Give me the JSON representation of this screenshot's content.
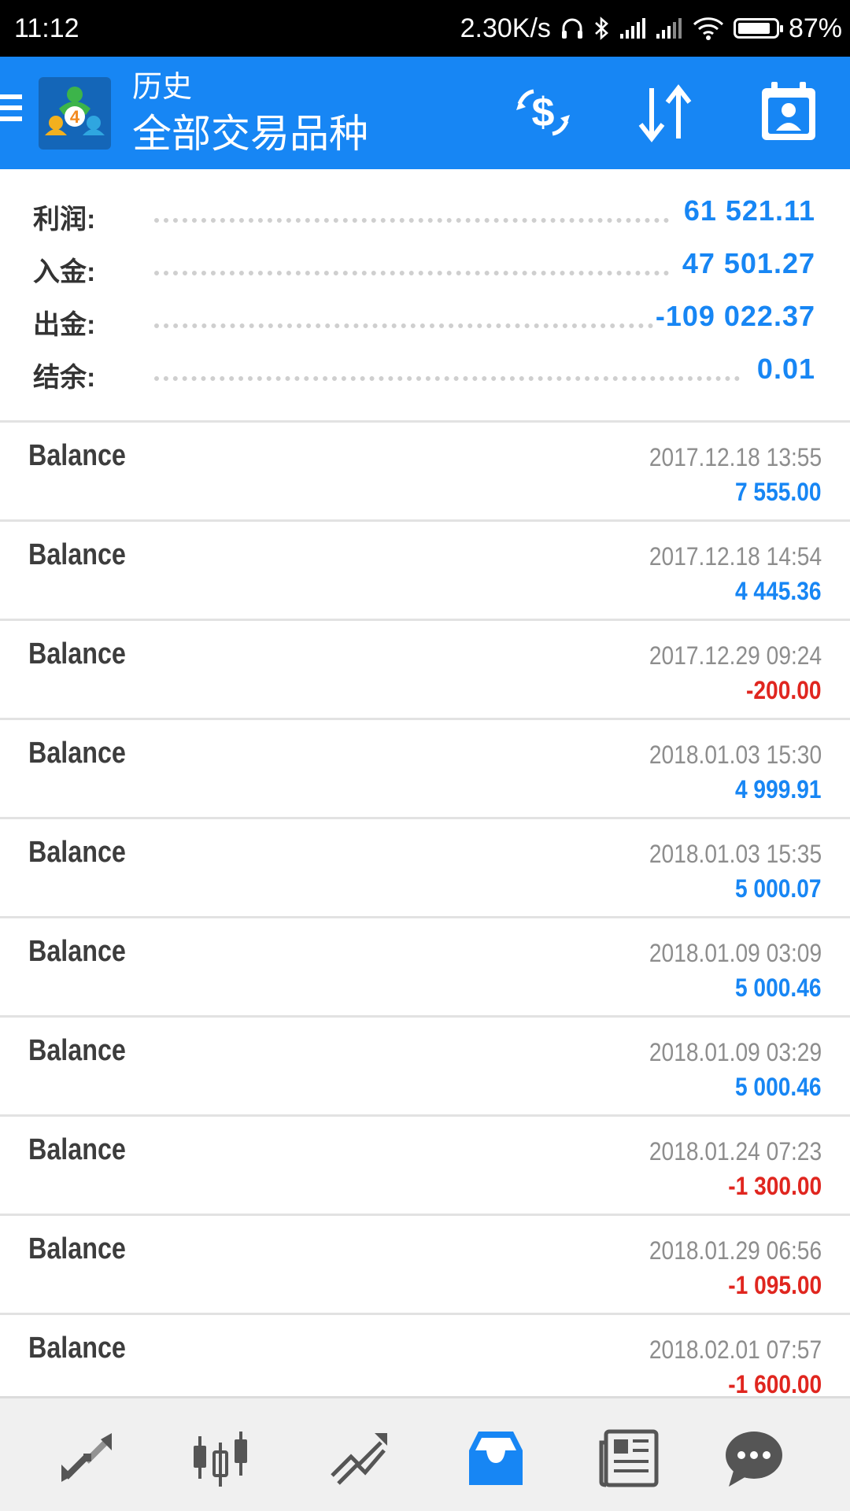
{
  "status_bar": {
    "time": "11:12",
    "network_speed": "2.30K/s",
    "battery_percent": "87%",
    "battery_level": 0.87,
    "icons": [
      "headphones-icon",
      "bluetooth-icon",
      "signal-icon",
      "signal-icon",
      "wifi-icon",
      "battery-icon"
    ]
  },
  "header": {
    "subtitle": "历史",
    "title": "全部交易品种",
    "actions": [
      "currency-exchange-icon",
      "sort-icon",
      "calendar-icon"
    ]
  },
  "summary": [
    {
      "label": "利润:",
      "value": "61 521.11"
    },
    {
      "label": "入金:",
      "value": "47 501.27"
    },
    {
      "label": "出金:",
      "value": "-109 022.37"
    },
    {
      "label": "结余:",
      "value": "0.01"
    }
  ],
  "entries": [
    {
      "title": "Balance",
      "time": "2017.12.18 13:55",
      "amount": "7 555.00",
      "sign": "pos"
    },
    {
      "title": "Balance",
      "time": "2017.12.18 14:54",
      "amount": "4 445.36",
      "sign": "pos"
    },
    {
      "title": "Balance",
      "time": "2017.12.29 09:24",
      "amount": "-200.00",
      "sign": "neg"
    },
    {
      "title": "Balance",
      "time": "2018.01.03 15:30",
      "amount": "4 999.91",
      "sign": "pos"
    },
    {
      "title": "Balance",
      "time": "2018.01.03 15:35",
      "amount": "5 000.07",
      "sign": "pos"
    },
    {
      "title": "Balance",
      "time": "2018.01.09 03:09",
      "amount": "5 000.46",
      "sign": "pos"
    },
    {
      "title": "Balance",
      "time": "2018.01.09 03:29",
      "amount": "5 000.46",
      "sign": "pos"
    },
    {
      "title": "Balance",
      "time": "2018.01.24 07:23",
      "amount": "-1 300.00",
      "sign": "neg"
    },
    {
      "title": "Balance",
      "time": "2018.01.29 06:56",
      "amount": "-1 095.00",
      "sign": "neg"
    },
    {
      "title": "Balance",
      "time": "2018.02.01 07:57",
      "amount": "-1 600.00",
      "sign": "neg"
    }
  ],
  "bottom_nav": {
    "items": [
      "quotes-icon",
      "chart-icon",
      "trade-icon",
      "history-icon",
      "news-icon",
      "chat-icon"
    ],
    "active": "history-icon"
  },
  "colors": {
    "brand": "#1786f4",
    "positive": "#1786f4",
    "negative": "#e0261f",
    "nav_inactive": "#555555"
  }
}
